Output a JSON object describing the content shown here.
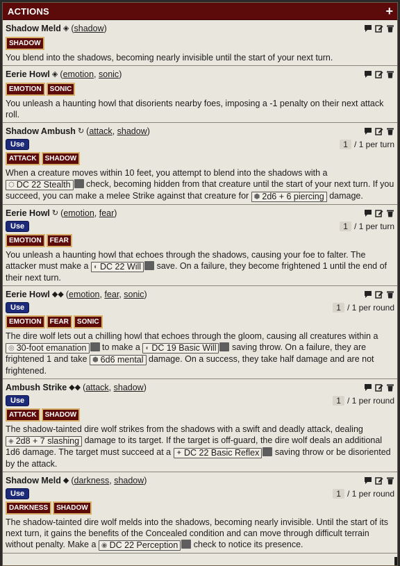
{
  "header": {
    "title": "ACTIONS",
    "add_label": "+"
  },
  "actions": [
    {
      "name": "Shadow Meld",
      "action_glyph": "◈",
      "traits_links": [
        "shadow"
      ],
      "traits": [
        "SHADOW"
      ],
      "description": "You blend into the shadows, becoming nearly invisible until the start of your next turn."
    },
    {
      "name": "Eerie Howl",
      "action_glyph": "◈",
      "traits_links": [
        "emotion",
        "sonic"
      ],
      "traits": [
        "EMOTION",
        "SONIC"
      ],
      "description": "You unleash a haunting howl that disorients nearby foes, imposing a -1 penalty on their next attack roll."
    },
    {
      "name": "Shadow Ambush",
      "action_glyph": "↻",
      "traits_links": [
        "attack",
        "shadow"
      ],
      "use_label": "Use",
      "uses_count": "1",
      "uses_text": "/ 1 per turn",
      "traits": [
        "ATTACK",
        "SHADOW"
      ],
      "desc_a": "When a creature moves within 10 feet, you attempt to blend into the shadows with a",
      "check_label": "DC 22 Stealth",
      "desc_b": "check, becoming hidden from that creature until the start of your next turn. If you succeed, you can make a melee Strike against that creature for",
      "damage_label": "2d6 + 6 piercing",
      "desc_c": "damage."
    },
    {
      "name": "Eerie Howl",
      "action_glyph": "↻",
      "traits_links": [
        "emotion",
        "fear"
      ],
      "use_label": "Use",
      "uses_count": "1",
      "uses_text": "/ 1 per turn",
      "traits": [
        "EMOTION",
        "FEAR"
      ],
      "desc_a": "You unleash a haunting howl that echoes through the shadows, causing your foe to falter. The attacker must make a",
      "check_label": "DC 22 Will",
      "desc_b": "save. On a failure, they become frightened 1 until the end of their next turn."
    },
    {
      "name": "Eerie Howl",
      "action_glyph": "◆◆",
      "traits_links": [
        "emotion",
        "fear",
        "sonic"
      ],
      "use_label": "Use",
      "uses_count": "1",
      "uses_text": "/ 1 per round",
      "traits": [
        "EMOTION",
        "FEAR",
        "SONIC"
      ],
      "desc_a": "The dire wolf lets out a chilling howl that echoes through the gloom, causing all creatures within a",
      "area_label": "30-foot emanation",
      "desc_b": "to make a",
      "check_label": "DC 19 Basic Will",
      "desc_c": "saving throw. On a failure, they are frightened 1 and take",
      "damage_label": "6d6 mental",
      "desc_d": "damage. On a success, they take half damage and are not frightened."
    },
    {
      "name": "Ambush Strike",
      "action_glyph": "◆◆",
      "traits_links": [
        "attack",
        "shadow"
      ],
      "use_label": "Use",
      "uses_count": "1",
      "uses_text": "/ 1 per round",
      "traits": [
        "ATTACK",
        "SHADOW"
      ],
      "desc_a": "The shadow-tainted dire wolf strikes from the shadows with a swift and deadly attack, dealing",
      "damage_label": "2d8 + 7 slashing",
      "desc_b": "damage to its target. If the target is off-guard, the dire wolf deals an additional 1d6 damage. The target must succeed at a",
      "check_label": "DC 22 Basic Reflex",
      "desc_c": "saving throw or be disoriented by the attack."
    },
    {
      "name": "Shadow Meld",
      "action_glyph": "◆",
      "traits_links": [
        "darkness",
        "shadow"
      ],
      "use_label": "Use",
      "uses_count": "1",
      "uses_text": "/ 1 per round",
      "traits": [
        "DARKNESS",
        "SHADOW"
      ],
      "desc_a": "The shadow-tainted dire wolf melds into the shadows, becoming nearly invisible. Until the start of its next turn, it gains the benefits of the Concealed condition and can move through difficult terrain without penalty. Make a",
      "check_label": "DC 22 Perception",
      "desc_b": "check to notice its presence."
    }
  ]
}
